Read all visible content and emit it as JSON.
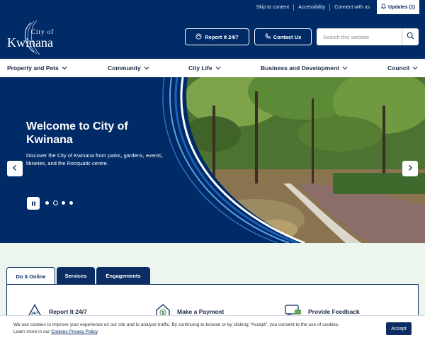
{
  "topbar": {
    "links": [
      "Skip to content",
      "Accessibility",
      "Connect with us"
    ],
    "updates_label": "Updates (1)"
  },
  "header": {
    "logo_city": "City of",
    "logo_name": "Kwinana",
    "report_label": "Report it 24/7",
    "contact_label": "Contact Us",
    "search_placeholder": "Search this website"
  },
  "nav": {
    "items": [
      "Property and Pets",
      "Community",
      "City Life",
      "Business and Development",
      "Council"
    ]
  },
  "hero": {
    "title": "Welcome to City of Kwinana",
    "text": "Discover the City of Kwinana from parks, gardens, events, libraries, and the Recquatic centre.",
    "slide_count": 4,
    "active_slide": 2
  },
  "tabs": {
    "items": [
      "Do it Online",
      "Services",
      "Engagements"
    ],
    "active": "Do it Online"
  },
  "tiles": [
    "Report It 24/7",
    "Make a Payment",
    "Provide Feedback"
  ],
  "cookie": {
    "text": "We use cookies to improve your experience on our site and to analyse traffic. By continuing to browse or by clicking \"Accept\", you consent to the use of cookies.",
    "learn_prefix": "Learn more in our",
    "policy_link": "Cookies Privacy Policy",
    "policy_suffix": ".",
    "accept_label": "Accept"
  },
  "colors": {
    "brand_navy": "#002b66",
    "tab_navy": "#0b2d63",
    "lower_bg": "#edf5ef"
  }
}
